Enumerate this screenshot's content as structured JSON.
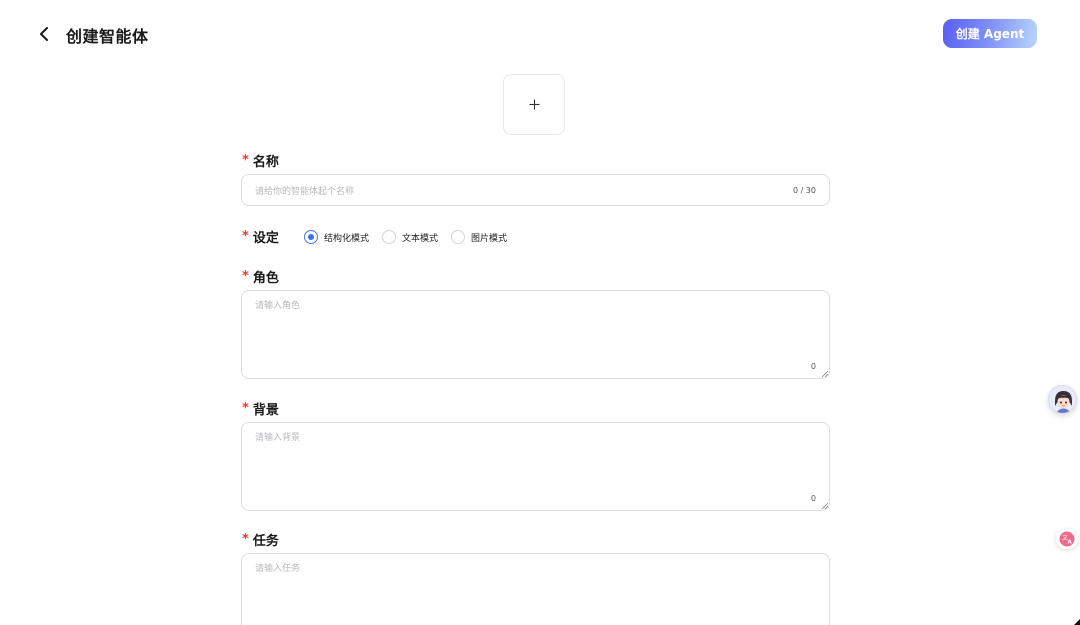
{
  "header": {
    "title": "创建智能体",
    "create_button": "创建 Agent"
  },
  "form": {
    "name": {
      "label": "名称",
      "required_mark": "*",
      "placeholder": "请给你的智能体起个名称",
      "counter": "0 / 30"
    },
    "setting": {
      "label": "设定",
      "required_mark": "*",
      "options": [
        "结构化模式",
        "文本模式",
        "图片模式"
      ],
      "selected": "结构化模式"
    },
    "role": {
      "label": "角色",
      "required_mark": "*",
      "placeholder": "请输入角色",
      "counter": "0"
    },
    "background": {
      "label": "背景",
      "required_mark": "*",
      "placeholder": "请输入背景",
      "counter": "0"
    },
    "task": {
      "label": "任务",
      "required_mark": "*",
      "placeholder": "请输入任务"
    }
  },
  "icons": {
    "back": "chevron-left-icon",
    "upload": "plus-icon",
    "assistant": "assistant-avatar-icon",
    "translate": "translate-icon"
  },
  "colors": {
    "required": "#e53935",
    "radio_checked": "#3b6cf4",
    "button_gradient_start": "#5b5ef0",
    "button_gradient_end": "#b9d6fb"
  }
}
